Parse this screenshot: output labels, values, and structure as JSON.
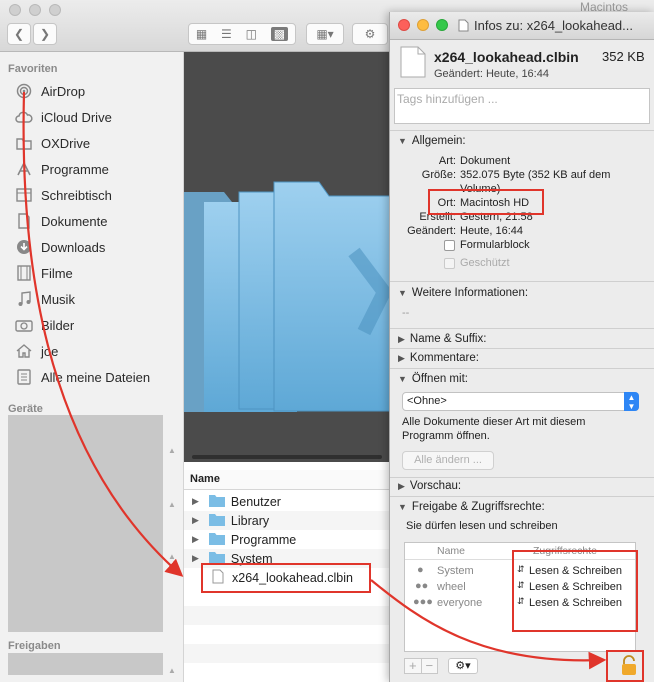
{
  "finder": {
    "volume_label": "Macintos",
    "sidebar": {
      "favorites_header": "Favoriten",
      "devices_header": "Geräte",
      "shares_header": "Freigaben",
      "items": [
        {
          "label": "AirDrop",
          "icon": "airdrop-icon"
        },
        {
          "label": "iCloud Drive",
          "icon": "cloud-icon"
        },
        {
          "label": "OXDrive",
          "icon": "folder-icon"
        },
        {
          "label": "Programme",
          "icon": "apps-icon"
        },
        {
          "label": "Schreibtisch",
          "icon": "desktop-icon"
        },
        {
          "label": "Dokumente",
          "icon": "document-icon"
        },
        {
          "label": "Downloads",
          "icon": "download-icon"
        },
        {
          "label": "Filme",
          "icon": "film-icon"
        },
        {
          "label": "Musik",
          "icon": "music-icon"
        },
        {
          "label": "Bilder",
          "icon": "camera-icon"
        },
        {
          "label": "joe",
          "icon": "home-icon"
        },
        {
          "label": "Alle meine Dateien",
          "icon": "all-files-icon"
        }
      ]
    },
    "list": {
      "column_header": "Name",
      "rows": [
        {
          "label": "Benutzer"
        },
        {
          "label": "Library"
        },
        {
          "label": "Programme"
        },
        {
          "label": "System"
        },
        {
          "label": "x264_lookahead.clbin"
        }
      ]
    }
  },
  "info": {
    "title": "Infos zu: x264_lookahead...",
    "file_name": "x264_lookahead.clbin",
    "file_size": "352 KB",
    "modified_short": "Geändert: Heute, 16:44",
    "tags_placeholder": "Tags hinzufügen ...",
    "general": {
      "header": "Allgemein:",
      "art_label": "Art:",
      "art_value": "Dokument",
      "size_label": "Größe:",
      "size_value": "352.075 Byte (352 KB auf dem",
      "size_value2": "Volume)",
      "ort_label": "Ort:",
      "ort_value": "Macintosh HD",
      "created_label": "Erstellt:",
      "created_value": "Gestern, 21:58",
      "changed_label": "Geändert:",
      "changed_value": "Heute, 16:44",
      "stationery": "Formularblock",
      "locked": "Geschützt"
    },
    "more_info": {
      "header": "Weitere Informationen:",
      "value": "--"
    },
    "name_ext": "Name & Suffix:",
    "comments": "Kommentare:",
    "open_with": {
      "header": "Öffnen mit:",
      "selected": "<Ohne>",
      "desc1": "Alle Dokumente dieser Art mit diesem",
      "desc2": "Programm öffnen.",
      "change_all": "Alle ändern ..."
    },
    "preview": "Vorschau:",
    "sharing": {
      "header": "Freigabe & Zugriffsrechte:",
      "desc": "Sie dürfen lesen und schreiben",
      "col_name": "Name",
      "col_priv": "Zugriffsrechte",
      "rows": [
        {
          "name": "System",
          "priv": "Lesen & Schreiben"
        },
        {
          "name": "wheel",
          "priv": "Lesen & Schreiben"
        },
        {
          "name": "everyone",
          "priv": "Lesen & Schreiben"
        }
      ]
    }
  },
  "colors": {
    "annotation": "#e0352b",
    "folder": "#7bbde5"
  }
}
